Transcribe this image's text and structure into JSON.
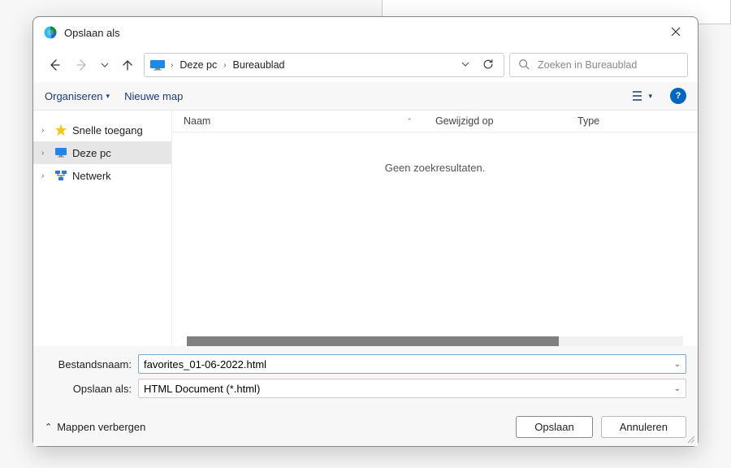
{
  "window_title": "Opslaan als",
  "nav": {
    "breadcrumbs": [
      "Deze pc",
      "Bureaublad"
    ]
  },
  "search": {
    "placeholder": "Zoeken in Bureaublad"
  },
  "toolbar": {
    "organise": "Organiseren",
    "newfolder": "Nieuwe map"
  },
  "sidebar": {
    "items": [
      {
        "label": "Snelle toegang"
      },
      {
        "label": "Deze pc"
      },
      {
        "label": "Netwerk"
      }
    ]
  },
  "columns": {
    "name": "Naam",
    "modified": "Gewijzigd op",
    "type": "Type"
  },
  "empty_message": "Geen zoekresultaten.",
  "form": {
    "filename_label": "Bestandsnaam:",
    "filename_value": "favorites_01-06-2022.html",
    "filetype_label": "Opslaan als:",
    "filetype_value": "HTML Document (*.html)"
  },
  "footer": {
    "hide_folders": "Mappen verbergen",
    "save": "Opslaan",
    "cancel": "Annuleren"
  }
}
